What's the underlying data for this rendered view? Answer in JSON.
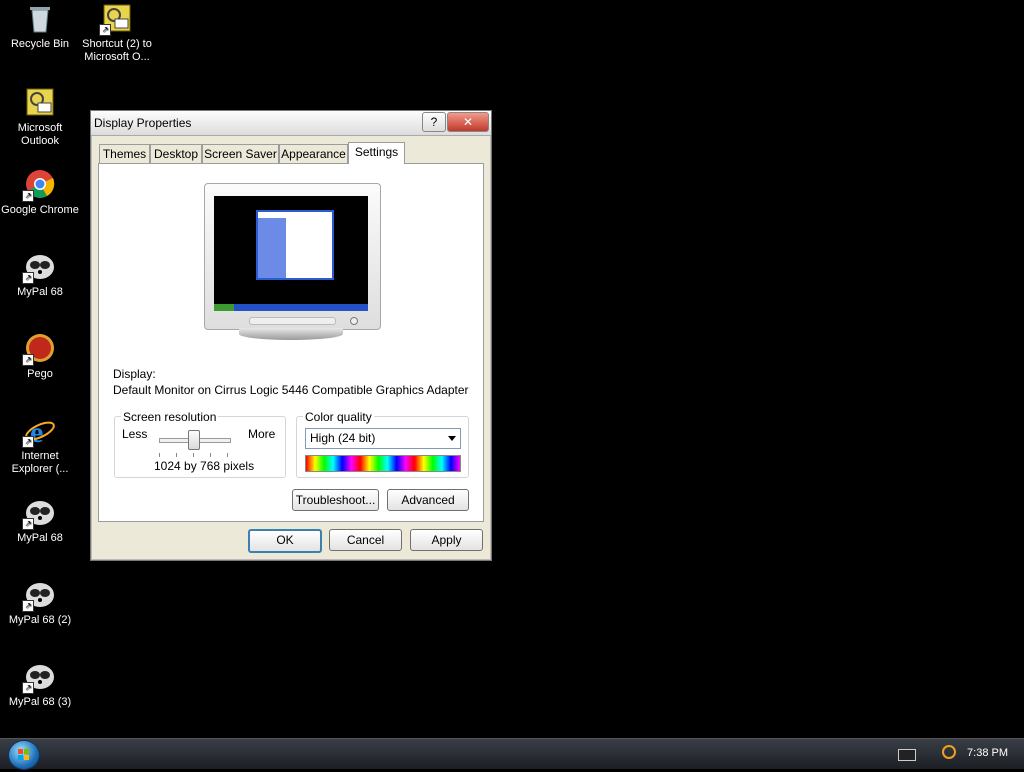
{
  "desktop": {
    "icons": [
      {
        "label": "Recycle Bin",
        "icon": "recycle-bin-icon"
      },
      {
        "label": "Shortcut (2) to Microsoft O...",
        "icon": "outlook-icon"
      },
      {
        "label": "Microsoft Outlook",
        "icon": "outlook-icon"
      },
      {
        "label": "Google Chrome",
        "icon": "chrome-icon"
      },
      {
        "label": "MyPal 68",
        "icon": "mypal-icon"
      },
      {
        "label": "Pego",
        "icon": "pego-icon"
      },
      {
        "label": "Internet Explorer (...",
        "icon": "ie-icon"
      },
      {
        "label": "MyPal 68",
        "icon": "mypal-icon"
      },
      {
        "label": "MyPal 68 (2)",
        "icon": "mypal-icon"
      },
      {
        "label": "MyPal 68 (3)",
        "icon": "mypal-icon"
      }
    ]
  },
  "taskbar": {
    "clock": "7:38 PM"
  },
  "dialog": {
    "title": "Display Properties",
    "help_glyph": "?",
    "close_glyph": "✕",
    "tabs": [
      {
        "label": "Themes"
      },
      {
        "label": "Desktop"
      },
      {
        "label": "Screen Saver"
      },
      {
        "label": "Appearance"
      },
      {
        "label": "Settings"
      }
    ],
    "active_tab": "Settings",
    "display_label": "Display:",
    "display_value": "Default Monitor on Cirrus Logic 5446 Compatible Graphics Adapter",
    "resolution": {
      "legend": "Screen resolution",
      "less": "Less",
      "more": "More",
      "value_text": "1024 by 768 pixels"
    },
    "color_quality": {
      "legend": "Color quality",
      "selected": "High (24 bit)"
    },
    "buttons": {
      "troubleshoot": "Troubleshoot...",
      "advanced": "Advanced",
      "ok": "OK",
      "cancel": "Cancel",
      "apply": "Apply"
    }
  },
  "colors": {
    "desktop_bg": "#000000",
    "dialog_bg": "#ece9d8",
    "panel_bg": "#ffffff",
    "close_red": "#c0392b"
  }
}
